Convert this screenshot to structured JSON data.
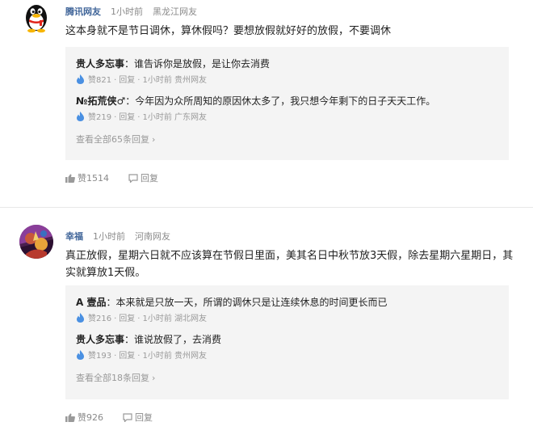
{
  "comments": [
    {
      "author": "腾讯网友",
      "time": "1小时前",
      "location": "黑龙江网友",
      "text": "这本身就不是节日调休，算休假吗？要想放假就好好的放假，不要调休",
      "avatar_icon": "qq-penguin-icon",
      "replies": [
        {
          "author": "贵人多忘事",
          "text": "：谁告诉你是放假，是让你去消费",
          "likes": "赞821",
          "reply_label": "回复",
          "time": "1小时前",
          "location": "贵州网友"
        },
        {
          "author": "№拓荒侠♂",
          "text": "：今年因为众所周知的原因休太多了，我只想今年剩下的日子天天工作。",
          "likes": "赞219",
          "reply_label": "回复",
          "time": "1小时前",
          "location": "广东网友"
        }
      ],
      "view_all": "查看全部65条回复",
      "likes": "赞1514",
      "reply_label": "回复"
    },
    {
      "author": "幸福",
      "time": "1小时前",
      "location": "河南网友",
      "text": "真正放假，星期六日就不应该算在节假日里面，美其名日中秋节放3天假，除去星期六星期日，其实就算放1天假。",
      "avatar_icon": "user-photo-avatar",
      "replies": [
        {
          "author": "A 壹品",
          "text": "：本来就是只放一天，所谓的调休只是让连续休息的时间更长而已",
          "likes": "赞216",
          "reply_label": "回复",
          "time": "1小时前",
          "location": "湖北网友"
        },
        {
          "author": "贵人多忘事",
          "text": "：谁说放假了，去消费",
          "likes": "赞193",
          "reply_label": "回复",
          "time": "1小时前",
          "location": "贵州网友"
        }
      ],
      "view_all": "查看全部18条回复",
      "likes": "赞926",
      "reply_label": "回复"
    }
  ],
  "colors": {
    "author_blue": "#406599",
    "reply_bg": "#f4f4f4",
    "like_icon_blue": "#4a90e2",
    "meta_gray": "#8a8a8a"
  }
}
